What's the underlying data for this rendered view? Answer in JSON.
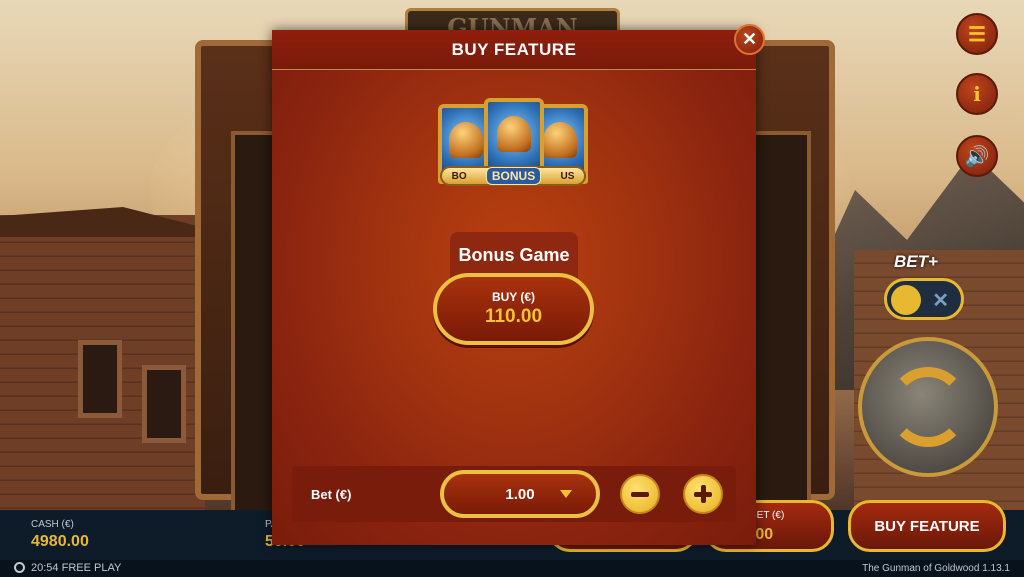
{
  "game": {
    "logo_text": "GUNMAN",
    "footer_time": "20:54",
    "footer_mode": "FREE PLAY",
    "footer_title": "The Gunman of Goldwood",
    "footer_version": "1.13.1"
  },
  "bottom_bar": {
    "cash_label": "CASH (€)",
    "cash_value": "4980.00",
    "pa_label": "PA",
    "pa_value": "50.00",
    "bet_label": "BET (€)",
    "bet_value": "1.00",
    "buy_feature_label": "BUY FEATURE"
  },
  "side_controls": {
    "betplus_label": "BET+",
    "betplus_enabled": false
  },
  "modal": {
    "title": "BUY FEATURE",
    "emblem_text_left": "BO",
    "emblem_text_center": "BONUS",
    "emblem_text_right": "US",
    "option_title": "Bonus Game",
    "buy_label": "BUY (€)",
    "buy_value": "110.00",
    "bet_label": "Bet (€)",
    "bet_value": "1.00"
  },
  "colors": {
    "accent_gold": "#ecc040",
    "modal_red": "#a33410",
    "bar_navy": "#0e1c2a"
  }
}
